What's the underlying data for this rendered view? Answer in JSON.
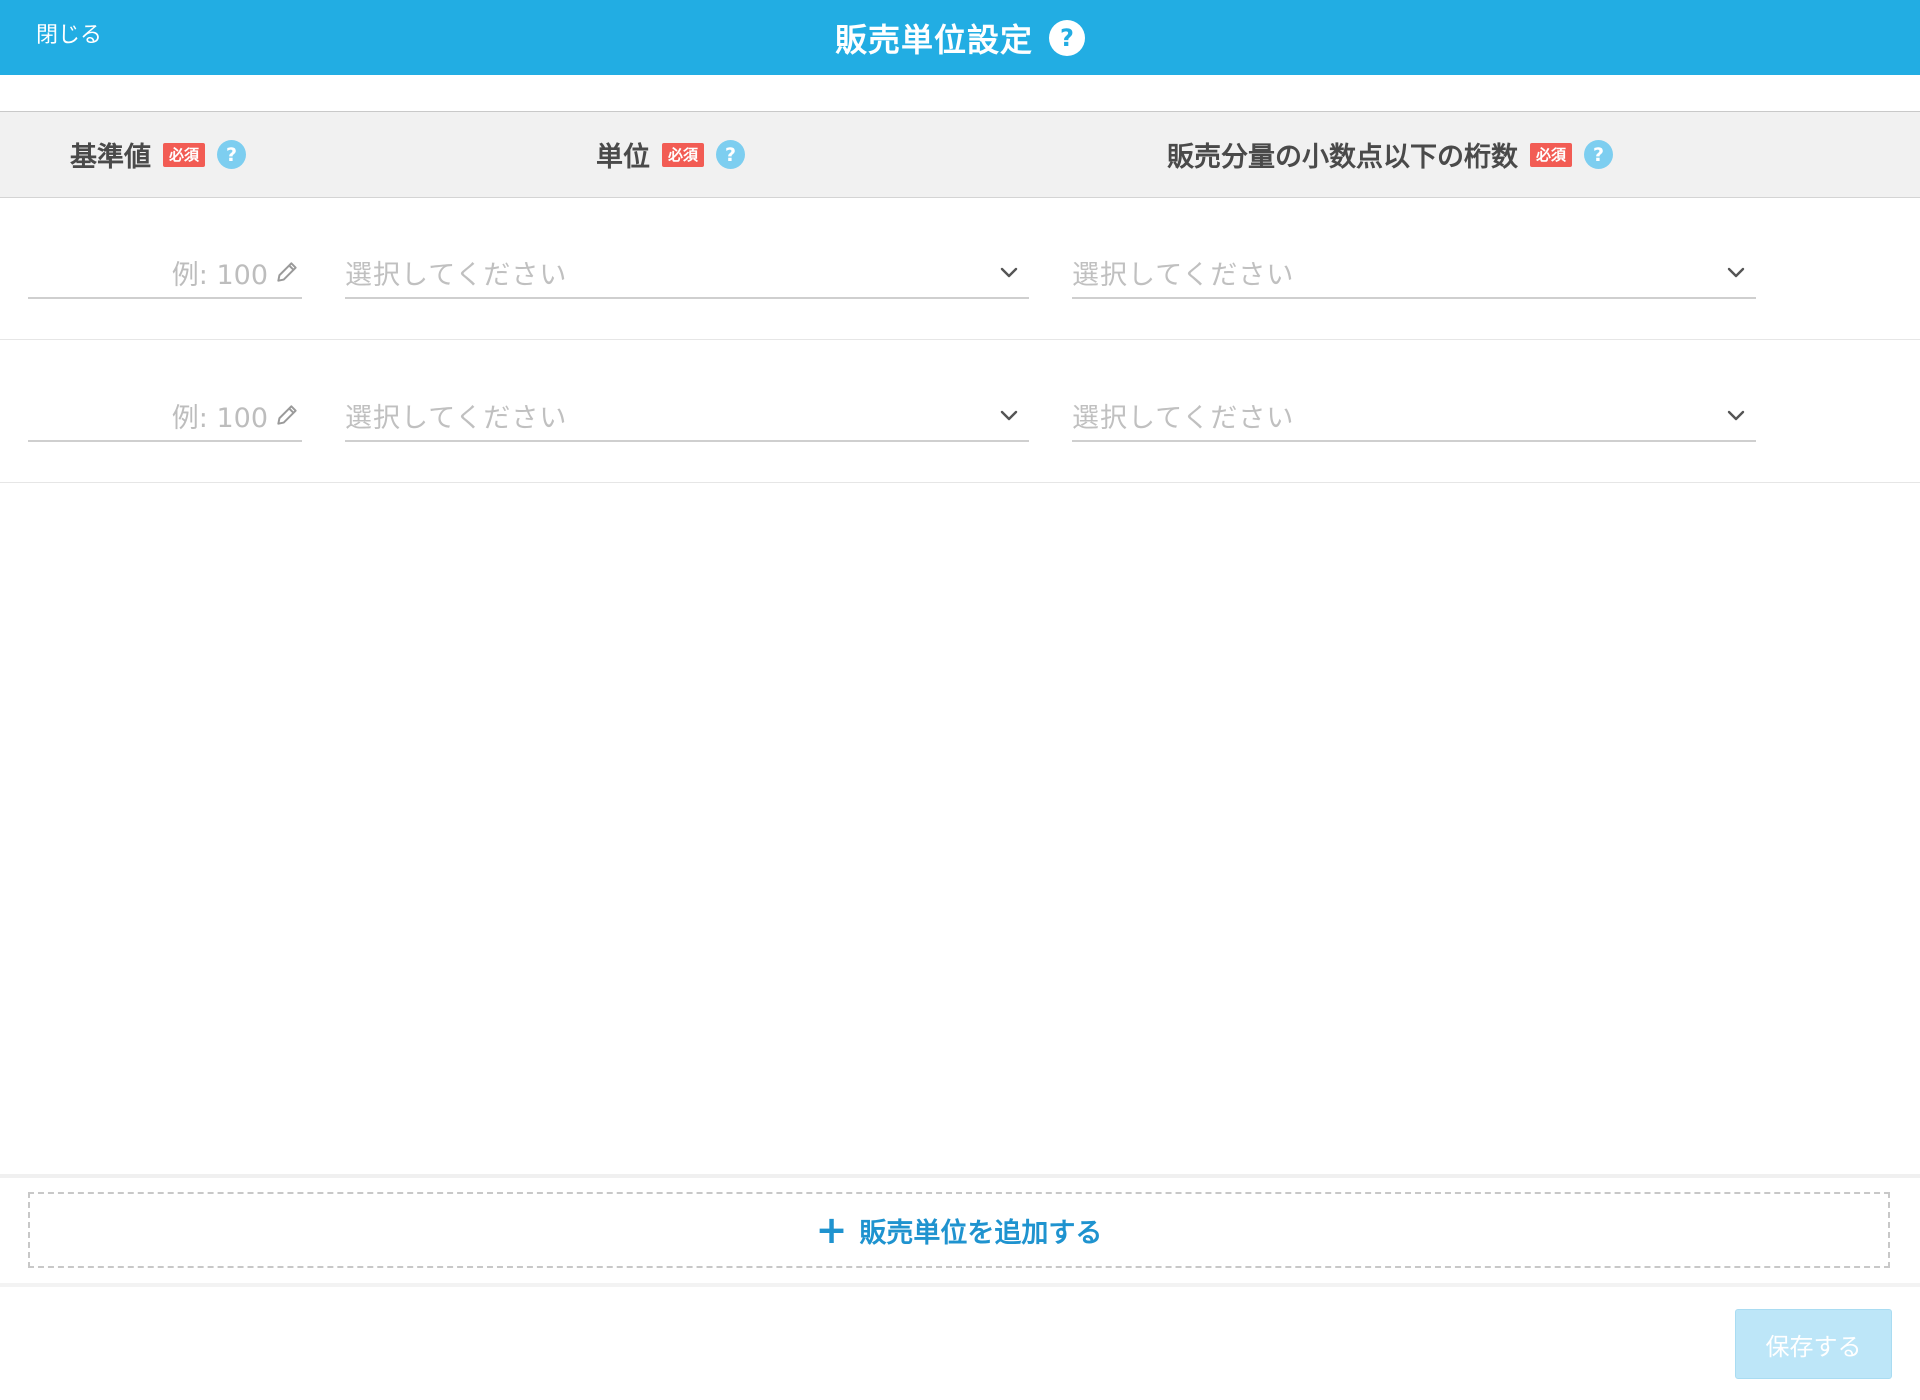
{
  "header": {
    "close_label": "閉じる",
    "title": "販売単位設定",
    "help_glyph": "?"
  },
  "columns": [
    {
      "label": "基準値",
      "required_badge": "必須",
      "help_glyph": "?"
    },
    {
      "label": "単位",
      "required_badge": "必須",
      "help_glyph": "?"
    },
    {
      "label": "販売分量の小数点以下の桁数",
      "required_badge": "必須",
      "help_glyph": "?"
    }
  ],
  "rows": [
    {
      "base_value": {
        "placeholder": "例: 100",
        "value": ""
      },
      "unit": {
        "placeholder": "選択してください",
        "value": ""
      },
      "decimal_places": {
        "placeholder": "選択してください",
        "value": ""
      }
    },
    {
      "base_value": {
        "placeholder": "例: 100",
        "value": ""
      },
      "unit": {
        "placeholder": "選択してください",
        "value": ""
      },
      "decimal_places": {
        "placeholder": "選択してください",
        "value": ""
      }
    }
  ],
  "actions": {
    "add_plus": "+",
    "add_label": "販売単位を追加する",
    "save_label": "保存する"
  },
  "colors": {
    "header_bg": "#22ade3",
    "required_badge": "#f25c54",
    "help_icon": "#7dcef0",
    "add_link": "#1f93cf",
    "save_disabled": "#bde6f8"
  },
  "icons": {
    "help": "help-circle-icon",
    "pencil": "pencil-icon",
    "dropdown": "chevron-down-icon",
    "add": "plus-icon"
  }
}
